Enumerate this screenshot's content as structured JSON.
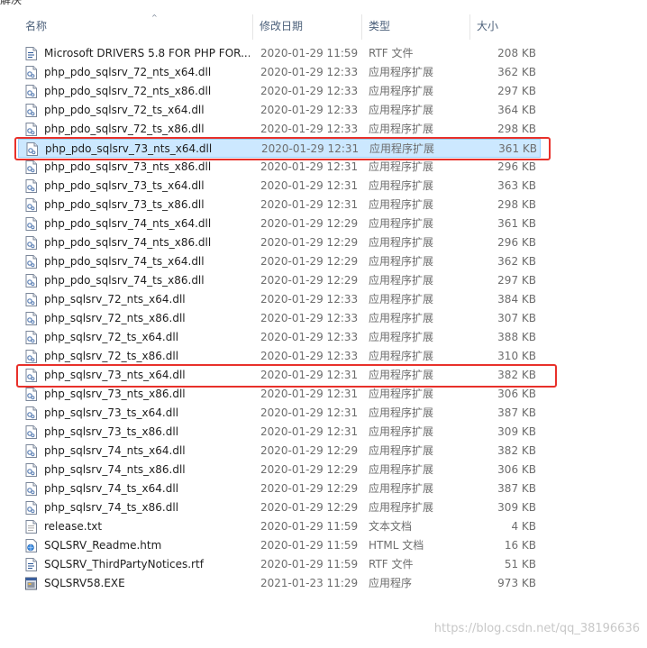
{
  "colors": {
    "selection_bg": "#cce8ff",
    "highlight_box": "#e8302a",
    "header_text": "#4c607a"
  },
  "columns": {
    "name": "名称",
    "modified": "修改日期",
    "type": "类型",
    "size": "大小"
  },
  "files": [
    {
      "name": "Microsoft DRIVERS 5.8 FOR PHP FOR...",
      "date": "2020-01-29 11:59",
      "type": "RTF 文件",
      "size": "208 KB",
      "icon": "rtf-file-icon"
    },
    {
      "name": "php_pdo_sqlsrv_72_nts_x64.dll",
      "date": "2020-01-29 12:33",
      "type": "应用程序扩展",
      "size": "362 KB",
      "icon": "dll-file-icon"
    },
    {
      "name": "php_pdo_sqlsrv_72_nts_x86.dll",
      "date": "2020-01-29 12:33",
      "type": "应用程序扩展",
      "size": "297 KB",
      "icon": "dll-file-icon"
    },
    {
      "name": "php_pdo_sqlsrv_72_ts_x64.dll",
      "date": "2020-01-29 12:33",
      "type": "应用程序扩展",
      "size": "364 KB",
      "icon": "dll-file-icon"
    },
    {
      "name": "php_pdo_sqlsrv_72_ts_x86.dll",
      "date": "2020-01-29 12:33",
      "type": "应用程序扩展",
      "size": "298 KB",
      "icon": "dll-file-icon"
    },
    {
      "name": "php_pdo_sqlsrv_73_nts_x64.dll",
      "date": "2020-01-29 12:31",
      "type": "应用程序扩展",
      "size": "361 KB",
      "icon": "dll-file-icon",
      "selected": true
    },
    {
      "name": "php_pdo_sqlsrv_73_nts_x86.dll",
      "date": "2020-01-29 12:31",
      "type": "应用程序扩展",
      "size": "296 KB",
      "icon": "dll-file-icon"
    },
    {
      "name": "php_pdo_sqlsrv_73_ts_x64.dll",
      "date": "2020-01-29 12:31",
      "type": "应用程序扩展",
      "size": "363 KB",
      "icon": "dll-file-icon"
    },
    {
      "name": "php_pdo_sqlsrv_73_ts_x86.dll",
      "date": "2020-01-29 12:31",
      "type": "应用程序扩展",
      "size": "298 KB",
      "icon": "dll-file-icon"
    },
    {
      "name": "php_pdo_sqlsrv_74_nts_x64.dll",
      "date": "2020-01-29 12:29",
      "type": "应用程序扩展",
      "size": "361 KB",
      "icon": "dll-file-icon"
    },
    {
      "name": "php_pdo_sqlsrv_74_nts_x86.dll",
      "date": "2020-01-29 12:29",
      "type": "应用程序扩展",
      "size": "296 KB",
      "icon": "dll-file-icon"
    },
    {
      "name": "php_pdo_sqlsrv_74_ts_x64.dll",
      "date": "2020-01-29 12:29",
      "type": "应用程序扩展",
      "size": "362 KB",
      "icon": "dll-file-icon"
    },
    {
      "name": "php_pdo_sqlsrv_74_ts_x86.dll",
      "date": "2020-01-29 12:29",
      "type": "应用程序扩展",
      "size": "297 KB",
      "icon": "dll-file-icon"
    },
    {
      "name": "php_sqlsrv_72_nts_x64.dll",
      "date": "2020-01-29 12:33",
      "type": "应用程序扩展",
      "size": "384 KB",
      "icon": "dll-file-icon"
    },
    {
      "name": "php_sqlsrv_72_nts_x86.dll",
      "date": "2020-01-29 12:33",
      "type": "应用程序扩展",
      "size": "307 KB",
      "icon": "dll-file-icon"
    },
    {
      "name": "php_sqlsrv_72_ts_x64.dll",
      "date": "2020-01-29 12:33",
      "type": "应用程序扩展",
      "size": "388 KB",
      "icon": "dll-file-icon"
    },
    {
      "name": "php_sqlsrv_72_ts_x86.dll",
      "date": "2020-01-29 12:33",
      "type": "应用程序扩展",
      "size": "310 KB",
      "icon": "dll-file-icon"
    },
    {
      "name": "php_sqlsrv_73_nts_x64.dll",
      "date": "2020-01-29 12:31",
      "type": "应用程序扩展",
      "size": "382 KB",
      "icon": "dll-file-icon"
    },
    {
      "name": "php_sqlsrv_73_nts_x86.dll",
      "date": "2020-01-29 12:31",
      "type": "应用程序扩展",
      "size": "306 KB",
      "icon": "dll-file-icon"
    },
    {
      "name": "php_sqlsrv_73_ts_x64.dll",
      "date": "2020-01-29 12:31",
      "type": "应用程序扩展",
      "size": "387 KB",
      "icon": "dll-file-icon"
    },
    {
      "name": "php_sqlsrv_73_ts_x86.dll",
      "date": "2020-01-29 12:31",
      "type": "应用程序扩展",
      "size": "309 KB",
      "icon": "dll-file-icon"
    },
    {
      "name": "php_sqlsrv_74_nts_x64.dll",
      "date": "2020-01-29 12:29",
      "type": "应用程序扩展",
      "size": "382 KB",
      "icon": "dll-file-icon"
    },
    {
      "name": "php_sqlsrv_74_nts_x86.dll",
      "date": "2020-01-29 12:29",
      "type": "应用程序扩展",
      "size": "306 KB",
      "icon": "dll-file-icon"
    },
    {
      "name": "php_sqlsrv_74_ts_x64.dll",
      "date": "2020-01-29 12:29",
      "type": "应用程序扩展",
      "size": "387 KB",
      "icon": "dll-file-icon"
    },
    {
      "name": "php_sqlsrv_74_ts_x86.dll",
      "date": "2020-01-29 12:29",
      "type": "应用程序扩展",
      "size": "309 KB",
      "icon": "dll-file-icon"
    },
    {
      "name": "release.txt",
      "date": "2020-01-29 11:59",
      "type": "文本文档",
      "size": "4 KB",
      "icon": "txt-file-icon"
    },
    {
      "name": "SQLSRV_Readme.htm",
      "date": "2020-01-29 11:59",
      "type": "HTML 文档",
      "size": "16 KB",
      "icon": "htm-file-icon"
    },
    {
      "name": "SQLSRV_ThirdPartyNotices.rtf",
      "date": "2020-01-29 11:59",
      "type": "RTF 文件",
      "size": "51 KB",
      "icon": "rtf-file-icon"
    },
    {
      "name": "SQLSRV58.EXE",
      "date": "2021-01-23 11:29",
      "type": "应用程序",
      "size": "973 KB",
      "icon": "exe-file-icon"
    }
  ],
  "highlight_rows": [
    5,
    17
  ],
  "watermark": "https://blog.csdn.net/qq_38196636"
}
